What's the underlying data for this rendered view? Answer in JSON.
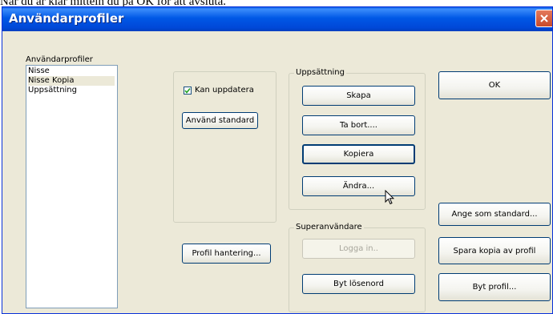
{
  "caption": "När du är klar mitteln du på OK för att avsluta.",
  "window": {
    "title": "Användarprofiler",
    "close_icon": "close-icon"
  },
  "profiles": {
    "label": "Användarprofiler",
    "items": [
      {
        "label": "Nisse",
        "selected": false
      },
      {
        "label": "Nisse Kopia",
        "selected": true
      },
      {
        "label": "Uppsättning",
        "selected": false
      }
    ]
  },
  "options": {
    "can_update_label": "Kan uppdatera",
    "can_update_checked": true,
    "use_standard_button": "Använd standard",
    "profile_manage_button": "Profil hantering..."
  },
  "setup": {
    "label": "Uppsättning",
    "create_button": "Skapa",
    "delete_button": "Ta bort....",
    "copy_button": "Kopiera",
    "change_button": "Ändra..."
  },
  "superuser": {
    "label": "Superanvändare",
    "login_button": "Logga in..",
    "change_password_button": "Byt lösenord"
  },
  "actions": {
    "ok_button": "OK",
    "set_default_button": "Ange som standard...",
    "save_copy_button": "Spara kopia av profil",
    "switch_profile_button": "Byt profil..."
  },
  "colors": {
    "titlebar": "#0058e6",
    "dialog_bg": "#ece9d8",
    "button_border": "#003c74"
  }
}
